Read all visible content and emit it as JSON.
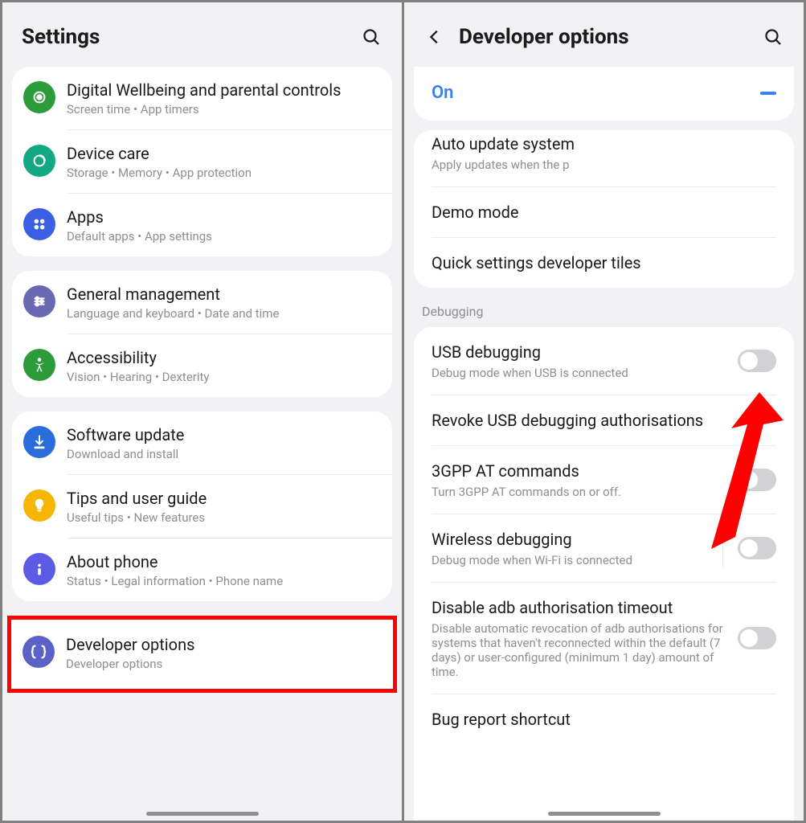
{
  "left": {
    "header_title": "Settings",
    "groups": [
      [
        {
          "icon": "wellbeing",
          "bg": "#2c9c3a",
          "title": "Digital Wellbeing and parental controls",
          "sub": "Screen time  •  App timers"
        },
        {
          "icon": "devicecare",
          "bg": "#11a883",
          "title": "Device care",
          "sub": "Storage  •  Memory  •  App protection"
        },
        {
          "icon": "apps",
          "bg": "#3a5fe2",
          "title": "Apps",
          "sub": "Default apps  •  App settings"
        }
      ],
      [
        {
          "icon": "general",
          "bg": "#6969b3",
          "title": "General management",
          "sub": "Language and keyboard  •  Date and time"
        },
        {
          "icon": "accessibility",
          "bg": "#2c9c3a",
          "title": "Accessibility",
          "sub": "Vision  •  Hearing  •  Dexterity"
        }
      ],
      [
        {
          "icon": "update",
          "bg": "#2b6cdb",
          "title": "Software update",
          "sub": "Download and install"
        },
        {
          "icon": "tips",
          "bg": "#f6b500",
          "title": "Tips and user guide",
          "sub": "Useful tips  •  New features"
        },
        {
          "icon": "about",
          "bg": "#5b5be6",
          "title": "About phone",
          "sub": "Status  •  Legal information  •  Phone name"
        }
      ]
    ],
    "highlight": {
      "icon": "developer",
      "bg": "#5b62c7",
      "title": "Developer options",
      "sub": "Developer options"
    }
  },
  "right": {
    "header_title": "Developer options",
    "on_label": "On",
    "section_label": "Debugging",
    "rows": [
      {
        "title": "Auto update system",
        "sub": "Apply updates when the p",
        "toggle": null,
        "cut_top": true
      },
      {
        "title": "Demo mode",
        "sub": "",
        "toggle": null
      },
      {
        "title": "Quick settings developer tiles",
        "sub": "",
        "toggle": null
      }
    ],
    "debug_rows": [
      {
        "title": "USB debugging",
        "sub": "Debug mode when USB is connected",
        "toggle": false
      },
      {
        "title": "Revoke USB debugging authorisations",
        "sub": "",
        "toggle": null
      },
      {
        "title": "3GPP AT commands",
        "sub": "Turn 3GPP AT commands on or off.",
        "toggle": false
      },
      {
        "title": "Wireless debugging",
        "sub": "Debug mode when Wi-Fi is connected",
        "toggle": false,
        "toggle_divider": true
      },
      {
        "title": "Disable adb authorisation timeout",
        "sub": "Disable automatic revocation of adb authorisations for systems that haven't reconnected within the default (7 days) or user-configured (minimum 1 day) amount of time.",
        "toggle": false
      },
      {
        "title": "Bug report shortcut",
        "sub": "",
        "toggle": null,
        "cut_bottom": true
      }
    ]
  }
}
